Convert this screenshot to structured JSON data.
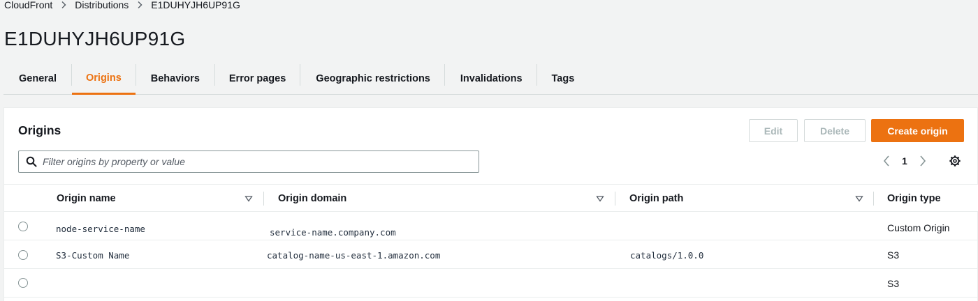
{
  "breadcrumb": {
    "items": [
      "CloudFront",
      "Distributions",
      "E1DUHYJH6UP91G"
    ]
  },
  "page_title": "E1DUHYJH6UP91G",
  "tabs": [
    {
      "label": "General"
    },
    {
      "label": "Origins"
    },
    {
      "label": "Behaviors"
    },
    {
      "label": "Error pages"
    },
    {
      "label": "Geographic restrictions"
    },
    {
      "label": "Invalidations"
    },
    {
      "label": "Tags"
    }
  ],
  "active_tab": "Origins",
  "origins_panel": {
    "title": "Origins",
    "edit_label": "Edit",
    "delete_label": "Delete",
    "create_label": "Create origin",
    "filter_placeholder": "Filter origins by property or value",
    "current_page": "1"
  },
  "table": {
    "columns": [
      "Origin name",
      "Origin domain",
      "Origin path",
      "Origin type"
    ],
    "rows": [
      {
        "name": "node-service-name",
        "domain": "service-name.company.com",
        "path": "",
        "type": "Custom Origin"
      },
      {
        "name": "S3-Custom Name",
        "domain": "catalog-name-us-east-1.amazon.com",
        "path": "catalogs/1.0.0",
        "type": "S3"
      },
      {
        "name": "",
        "domain": "",
        "path": "",
        "type": "S3"
      }
    ]
  },
  "colors": {
    "accent": "#ec7211",
    "text": "#16191f",
    "border": "#d5dbdb",
    "background": "#f2f3f3"
  }
}
